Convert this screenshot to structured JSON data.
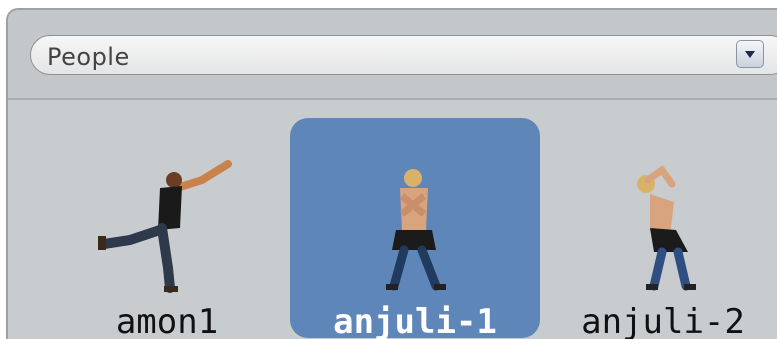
{
  "category_dropdown": {
    "selected": "People",
    "button_icon": "chevron-down-icon"
  },
  "sprites": [
    {
      "name": "amon1",
      "selected": false
    },
    {
      "name": "anjuli-1",
      "selected": true
    },
    {
      "name": "anjuli-2",
      "selected": false
    }
  ],
  "colors": {
    "selection": "#5f86b9",
    "panel": "#c9ccce"
  }
}
